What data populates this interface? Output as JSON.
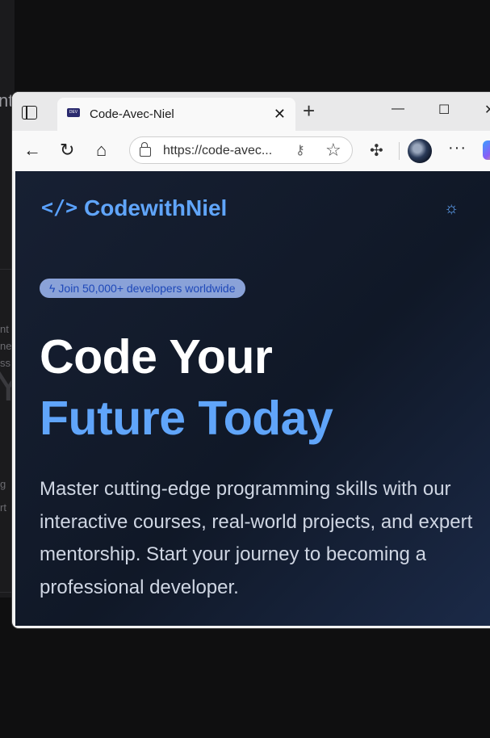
{
  "background_window": {
    "fragments": [
      "nt",
      "nt",
      "ner",
      "ss",
      "Y",
      "g",
      "rt"
    ]
  },
  "browser": {
    "tab": {
      "favicon_label": "DEV",
      "title": "Code-Avec-Niel",
      "close_glyph": "✕"
    },
    "new_tab_glyph": "+",
    "window_controls": {
      "minimize": "—",
      "maximize": "☐",
      "close": "✕"
    },
    "nav": {
      "back": "←",
      "reload": "↻",
      "home": "⌂",
      "url": "https://code-avec...",
      "more": "···"
    }
  },
  "page": {
    "logo_icon": "</>",
    "site_name": "CodewithNiel",
    "badge": "Join 50,000+ developers worldwide",
    "headline_line1": "Code Your",
    "headline_line2": "Future Today",
    "description": "Master cutting-edge programming skills with our interactive courses, real-world projects, and expert mentorship. Start your journey to becoming a professional developer."
  },
  "colors": {
    "accent": "#60a5fa",
    "page_bg": "#111827",
    "badge_bg": "#8aa2d8",
    "badge_text": "#1e48b8"
  }
}
